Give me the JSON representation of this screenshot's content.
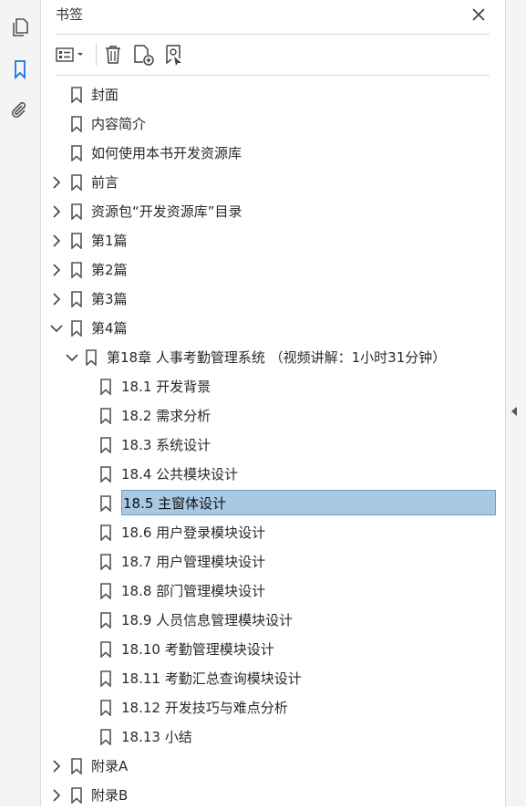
{
  "panel": {
    "title": "书签",
    "close_icon": "close-icon"
  },
  "left_nav": [
    {
      "name": "pages-icon"
    },
    {
      "name": "bookmarks-icon",
      "active": true
    },
    {
      "name": "attachments-icon"
    }
  ],
  "toolbar": [
    {
      "name": "options-menu-icon"
    },
    {
      "name": "delete-bookmark-icon"
    },
    {
      "name": "new-bookmark-icon"
    },
    {
      "name": "new-bookmark-from-structure-icon"
    }
  ],
  "colors": {
    "selection": "#a9c8e3",
    "selection_border": "#6f9bc4",
    "active_nav": "#1a73e8"
  },
  "bookmarks": [
    {
      "label": "封面",
      "level": 0,
      "expander": "none"
    },
    {
      "label": "内容简介",
      "level": 0,
      "expander": "none"
    },
    {
      "label": "如何使用本书开发资源库",
      "level": 0,
      "expander": "none"
    },
    {
      "label": "前言",
      "level": 0,
      "expander": "collapsed"
    },
    {
      "label": "资源包“开发资源库”目录",
      "level": 0,
      "expander": "collapsed"
    },
    {
      "label": "第1篇",
      "level": 0,
      "expander": "collapsed"
    },
    {
      "label": "第2篇",
      "level": 0,
      "expander": "collapsed"
    },
    {
      "label": "第3篇",
      "level": 0,
      "expander": "collapsed"
    },
    {
      "label": "第4篇",
      "level": 0,
      "expander": "expanded"
    },
    {
      "label": "第18章 人事考勤管理系统 （视频讲解：1小时31分钟）",
      "level": 1,
      "expander": "expanded"
    },
    {
      "label": "18.1 开发背景",
      "level": 2,
      "expander": "none"
    },
    {
      "label": "18.2 需求分析",
      "level": 2,
      "expander": "none"
    },
    {
      "label": "18.3 系统设计",
      "level": 2,
      "expander": "none"
    },
    {
      "label": "18.4 公共模块设计",
      "level": 2,
      "expander": "none"
    },
    {
      "label": "18.5 主窗体设计",
      "level": 2,
      "expander": "none",
      "selected": true
    },
    {
      "label": "18.6 用户登录模块设计",
      "level": 2,
      "expander": "none"
    },
    {
      "label": "18.7 用户管理模块设计",
      "level": 2,
      "expander": "none"
    },
    {
      "label": "18.8 部门管理模块设计",
      "level": 2,
      "expander": "none"
    },
    {
      "label": "18.9 人员信息管理模块设计",
      "level": 2,
      "expander": "none"
    },
    {
      "label": "18.10 考勤管理模块设计",
      "level": 2,
      "expander": "none"
    },
    {
      "label": "18.11 考勤汇总查询模块设计",
      "level": 2,
      "expander": "none"
    },
    {
      "label": "18.12 开发技巧与难点分析",
      "level": 2,
      "expander": "none"
    },
    {
      "label": "18.13 小结",
      "level": 2,
      "expander": "none"
    },
    {
      "label": "附录A",
      "level": 0,
      "expander": "collapsed"
    },
    {
      "label": "附录B",
      "level": 0,
      "expander": "collapsed"
    }
  ]
}
